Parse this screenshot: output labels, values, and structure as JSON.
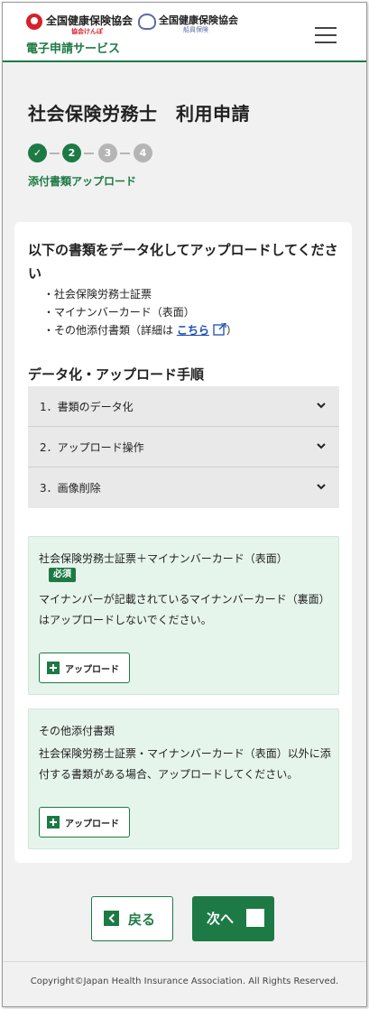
{
  "header": {
    "logo_primary_name": "全国健康保険協会",
    "logo_primary_sub": "協会けんぽ",
    "logo_secondary_name": "全国健康保険協会",
    "logo_secondary_sub": "船員保険",
    "service_name": "電子申請サービス",
    "menu_icon": "hamburger-menu-icon"
  },
  "page": {
    "title": "社会保険労務士　利用申請",
    "steps": [
      {
        "label": "✓",
        "state": "done"
      },
      {
        "label": "2",
        "state": "current"
      },
      {
        "label": "3",
        "state": "todo"
      },
      {
        "label": "4",
        "state": "todo"
      }
    ],
    "current_step_label": "添付書類アップロード"
  },
  "card": {
    "instruction": "以下の書類をデータ化してアップロードしてください",
    "documents": [
      "社会保険労務士証票",
      "マイナンバーカード（表面）"
    ],
    "other_doc_prefix": "その他添付書類（詳細は ",
    "other_doc_link": "こちら",
    "other_doc_suffix": "）",
    "procedure_heading": "データ化・アップロード手順",
    "accordion": [
      {
        "label": "1．書類のデータ化"
      },
      {
        "label": "2．アップロード操作"
      },
      {
        "label": "3．画像削除"
      }
    ],
    "upload_sections": [
      {
        "title": "社会保険労務士証票＋マイナンバーカード（表面）",
        "required_label": "必須",
        "note": "マイナンバーが記載されているマイナンバーカード（裏面）はアップロードしないでください。",
        "button_label": "アップロード"
      },
      {
        "title": "その他添付書類",
        "note": "社会保険労務士証票・マイナンバーカード（表面）以外に添付する書類がある場合、アップロードしてください。",
        "button_label": "アップロード"
      }
    ]
  },
  "nav": {
    "back_label": "戻る",
    "next_label": "次へ"
  },
  "footer": {
    "copyright": "Copyright©Japan Health Insurance Association. All Rights Reserved."
  },
  "colors": {
    "brand_green": "#1d7a45",
    "panel_green": "#e6f5ec",
    "link_blue": "#1a4db3",
    "logo_red": "#d6202a"
  }
}
